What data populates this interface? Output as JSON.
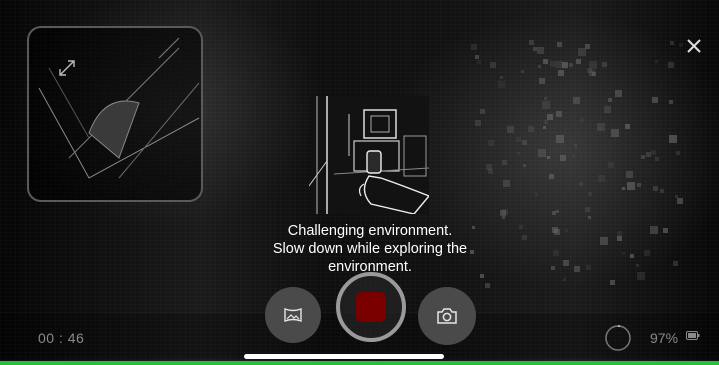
{
  "hint": {
    "line1": "Challenging environment.",
    "line2": "Slow down while exploring the",
    "line3": "environment."
  },
  "recording": {
    "timer": "00 : 46",
    "battery": "97%"
  },
  "colors": {
    "accent_green": "#22c23a",
    "record_red": "#7a0000",
    "control_gray": "#4a4a4a"
  },
  "icons": {
    "close": "close-icon",
    "expand": "expand-icon",
    "gallery": "gallery-icon",
    "camera": "camera-icon",
    "battery": "battery-icon"
  }
}
